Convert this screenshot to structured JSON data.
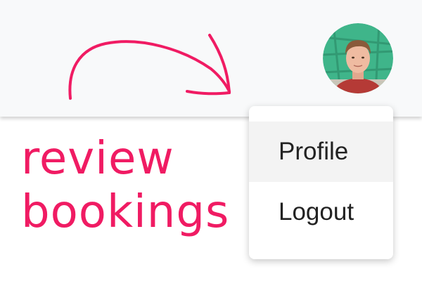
{
  "header": {
    "avatar": {
      "icon": "user-avatar-photo",
      "ring_color": "#3fb58a"
    }
  },
  "dropdown": {
    "items": [
      {
        "label": "Profile",
        "highlighted": true
      },
      {
        "label": "Logout",
        "highlighted": false
      }
    ]
  },
  "annotation": {
    "line1": "review",
    "line2": "bookings",
    "color": "#f01b63",
    "arrow_icon": "curved-arrow-icon"
  }
}
